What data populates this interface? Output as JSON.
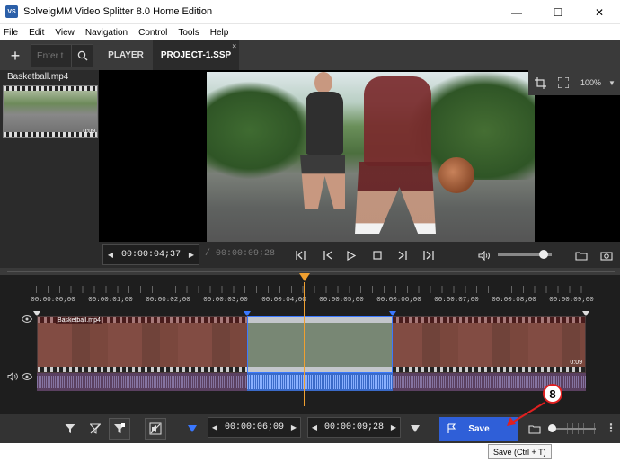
{
  "window": {
    "title": "SolveigMM Video Splitter 8.0 Home Edition",
    "logo_text": "VS",
    "minimize": "—",
    "maximize": "☐",
    "close": "✕"
  },
  "menu": {
    "items": [
      "File",
      "Edit",
      "View",
      "Navigation",
      "Control",
      "Tools",
      "Help"
    ]
  },
  "topbar": {
    "add_label": "+",
    "search_placeholder": "Enter t",
    "tabs": [
      {
        "label": "PLAYER"
      },
      {
        "label": "PROJECT-1.SSP"
      }
    ],
    "tab_close": "×"
  },
  "sidebar": {
    "file_name": "Basketball.mp4",
    "thumb_time": "0:09"
  },
  "preview": {
    "zoom_label": "100%",
    "zoom_chevron": "▼"
  },
  "controls": {
    "current_time": "00:00:04;37",
    "total_time": "/ 00:00:09;28",
    "prev_arrow": "◀",
    "next_arrow": "▶",
    "volume_level": 0.85
  },
  "timeline": {
    "ruler_labels": [
      "00:00:00;00",
      "00:00:01;00",
      "00:00:02;00",
      "00:00:03;00",
      "00:00:04;00",
      "00:00:05;00",
      "00:00:06;00",
      "00:00:07;00",
      "00:00:08;00",
      "00:00:09;00"
    ],
    "clip_label": "Basketball.mp4",
    "clip_end_time": "0:09"
  },
  "bottombar": {
    "marker_in_time": "00:00:06;09",
    "marker_out_time": "00:00:09;28",
    "prev_arrow": "◀",
    "next_arrow": "▶",
    "save_label": "Save",
    "more": "⋮"
  },
  "tooltip": {
    "text": "Save (Ctrl + T)"
  },
  "callout": {
    "number": "8",
    "color": "#e02020"
  },
  "colors": {
    "accent": "#2f5fd8",
    "playhead": "#f0a030",
    "selection": "#3a78ff"
  }
}
